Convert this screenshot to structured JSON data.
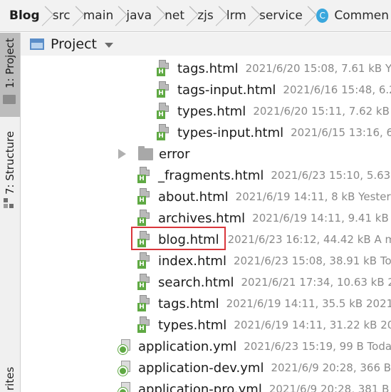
{
  "breadcrumb": {
    "items": [
      "Blog",
      "src",
      "main",
      "java",
      "net",
      "zjs",
      "lrm",
      "service"
    ],
    "last": "Commen",
    "last_icon": "C"
  },
  "toolstrip": {
    "project_label": "1: Project",
    "structure_label": "7: Structure",
    "favorites_label": "rites"
  },
  "panel": {
    "title": "Project"
  },
  "tree": [
    {
      "name": "tags.html",
      "meta": "2021/6/20 15:08, 7.61 kB Ye",
      "icon": "html-icon"
    },
    {
      "name": "tags-input.html",
      "meta": "2021/6/16 15:48, 6.2",
      "icon": "html-icon"
    },
    {
      "name": "types.html",
      "meta": "2021/6/20 15:11, 7.62 kB Y",
      "icon": "html-icon"
    },
    {
      "name": "types-input.html",
      "meta": "2021/6/15 13:16, 6.",
      "icon": "html-icon"
    },
    {
      "name": "error",
      "meta": "",
      "icon": "folder-icon"
    },
    {
      "name": "_fragments.html",
      "meta": "2021/6/23 15:10, 5.63 k",
      "icon": "html-icon"
    },
    {
      "name": "about.html",
      "meta": "2021/6/19 14:11, 8 kB Yesterc",
      "icon": "html-icon"
    },
    {
      "name": "archives.html",
      "meta": "2021/6/19 14:11, 9.41 kB Ye",
      "icon": "html-icon"
    },
    {
      "name": "blog.html",
      "meta": "2021/6/23 16:12, 44.42 kB A mi",
      "icon": "html-icon"
    },
    {
      "name": "index.html",
      "meta": "2021/6/23 15:08, 38.91 kB Toc",
      "icon": "html-icon"
    },
    {
      "name": "search.html",
      "meta": "2021/6/21 17:34, 10.63 kB 20",
      "icon": "html-icon"
    },
    {
      "name": "tags.html",
      "meta": "2021/6/19 14:11, 35.5 kB 2021/",
      "icon": "html-icon"
    },
    {
      "name": "types.html",
      "meta": "2021/6/19 14:11, 31.22 kB 202",
      "icon": "html-icon"
    },
    {
      "name": "application.yml",
      "meta": "2021/6/23 15:19, 99 B Today",
      "icon": "yml-icon"
    },
    {
      "name": "application-dev.yml",
      "meta": "2021/6/9 20:28, 366 B 2",
      "icon": "yml-icon"
    },
    {
      "name": "application-pro.yml",
      "meta": "2021/6/9 20:28, 381 B 2",
      "icon": "yml-icon"
    }
  ]
}
